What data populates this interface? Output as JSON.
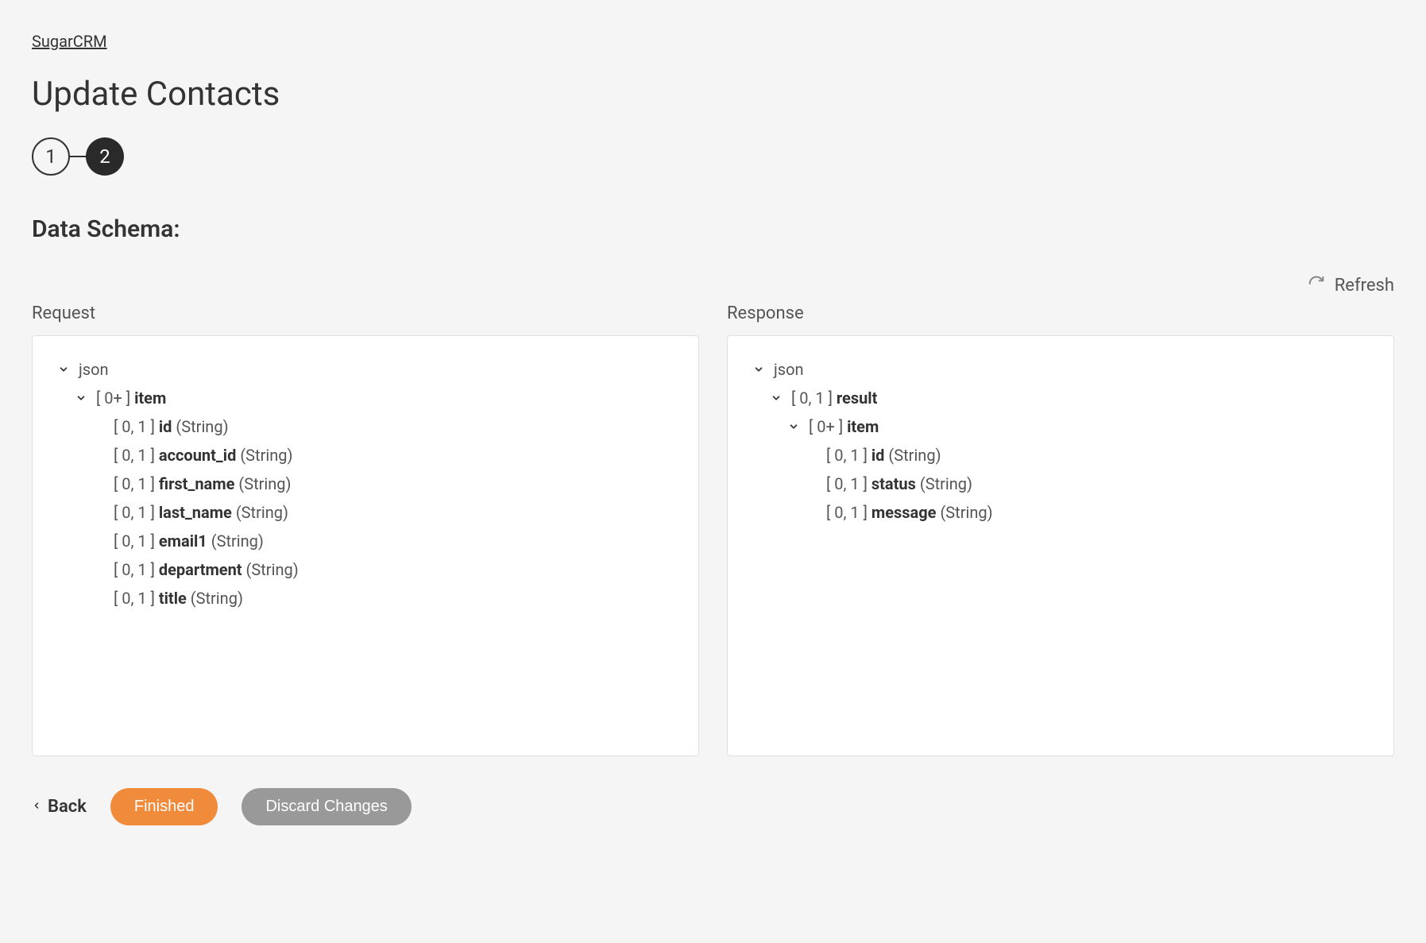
{
  "breadcrumb": "SugarCRM",
  "page_title": "Update Contacts",
  "stepper": {
    "step1": "1",
    "step2": "2",
    "active": 2
  },
  "section_heading": "Data Schema:",
  "refresh_label": "Refresh",
  "request": {
    "label": "Request",
    "root": {
      "label": "json",
      "item": {
        "card": "[ 0+ ]",
        "name": "item",
        "fields": [
          {
            "card": "[ 0, 1 ]",
            "name": "id",
            "type": "(String)"
          },
          {
            "card": "[ 0, 1 ]",
            "name": "account_id",
            "type": "(String)"
          },
          {
            "card": "[ 0, 1 ]",
            "name": "first_name",
            "type": "(String)"
          },
          {
            "card": "[ 0, 1 ]",
            "name": "last_name",
            "type": "(String)"
          },
          {
            "card": "[ 0, 1 ]",
            "name": "email1",
            "type": "(String)"
          },
          {
            "card": "[ 0, 1 ]",
            "name": "department",
            "type": "(String)"
          },
          {
            "card": "[ 0, 1 ]",
            "name": "title",
            "type": "(String)"
          }
        ]
      }
    }
  },
  "response": {
    "label": "Response",
    "root": {
      "label": "json",
      "result": {
        "card": "[ 0, 1 ]",
        "name": "result",
        "item": {
          "card": "[ 0+ ]",
          "name": "item",
          "fields": [
            {
              "card": "[ 0, 1 ]",
              "name": "id",
              "type": "(String)"
            },
            {
              "card": "[ 0, 1 ]",
              "name": "status",
              "type": "(String)"
            },
            {
              "card": "[ 0, 1 ]",
              "name": "message",
              "type": "(String)"
            }
          ]
        }
      }
    }
  },
  "footer": {
    "back": "Back",
    "finished": "Finished",
    "discard": "Discard Changes"
  }
}
